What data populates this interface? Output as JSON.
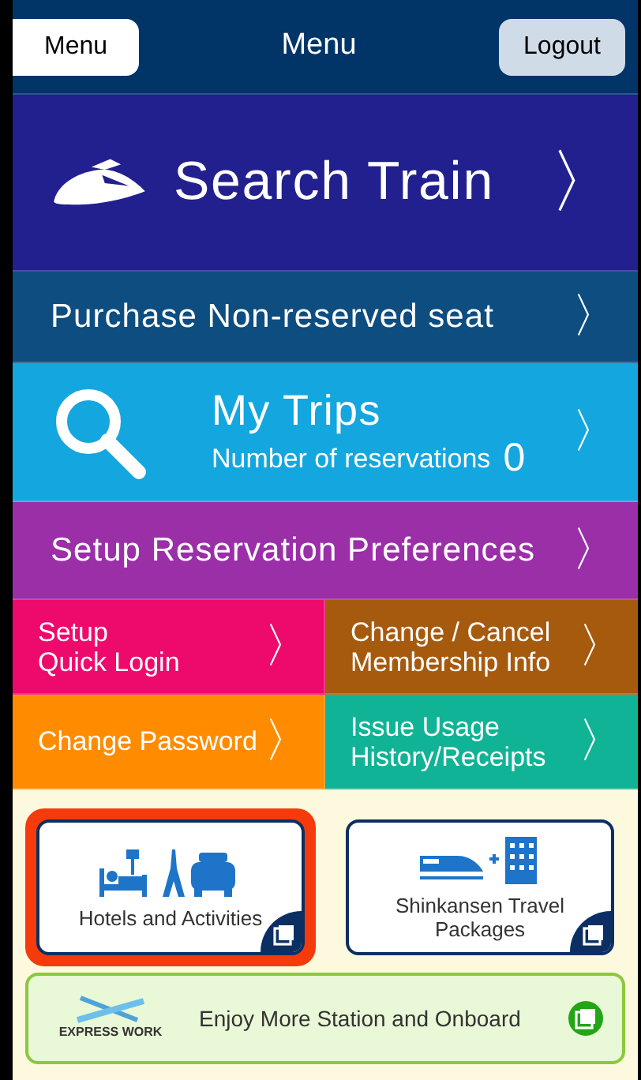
{
  "header": {
    "left_button": "Menu",
    "title": "Menu",
    "right_button": "Logout"
  },
  "menu": [
    {
      "kind": "hero",
      "label": "Search Train",
      "arrow": "〉",
      "color": "#22208e"
    },
    {
      "kind": "plain",
      "label": "Purchase Non-reserved seat",
      "arrow": "〉",
      "color": "#0d4d80"
    },
    {
      "kind": "trips",
      "label": "My Trips",
      "sub": "Number of reservations",
      "count": "0",
      "arrow": "〉",
      "color": "#14a6df"
    },
    {
      "kind": "plain",
      "label": "Setup Reservation Preferences",
      "arrow": "〉",
      "color": "#9a2fa8"
    }
  ],
  "grid": [
    {
      "label": "Setup\nQuick Login",
      "arrow": "〉",
      "color": "#ee0a6c"
    },
    {
      "label": "Change / Cancel\nMembership Info",
      "arrow": "〉",
      "color": "#a65a0e"
    },
    {
      "label": "Change Password",
      "arrow": "〉",
      "color": "#ff8c00"
    },
    {
      "label": "Issue Usage\nHistory/Receipts",
      "arrow": "〉",
      "color": "#11b396"
    }
  ],
  "cards": [
    {
      "kind": "hotels",
      "label": "Hotels and Activities",
      "highlighted": true
    },
    {
      "kind": "packages",
      "label": "Shinkansen Travel Packages",
      "highlighted": false
    }
  ],
  "banner": {
    "logo": "EXPRESS WORK",
    "label": "Enjoy More Station and Onboard"
  }
}
